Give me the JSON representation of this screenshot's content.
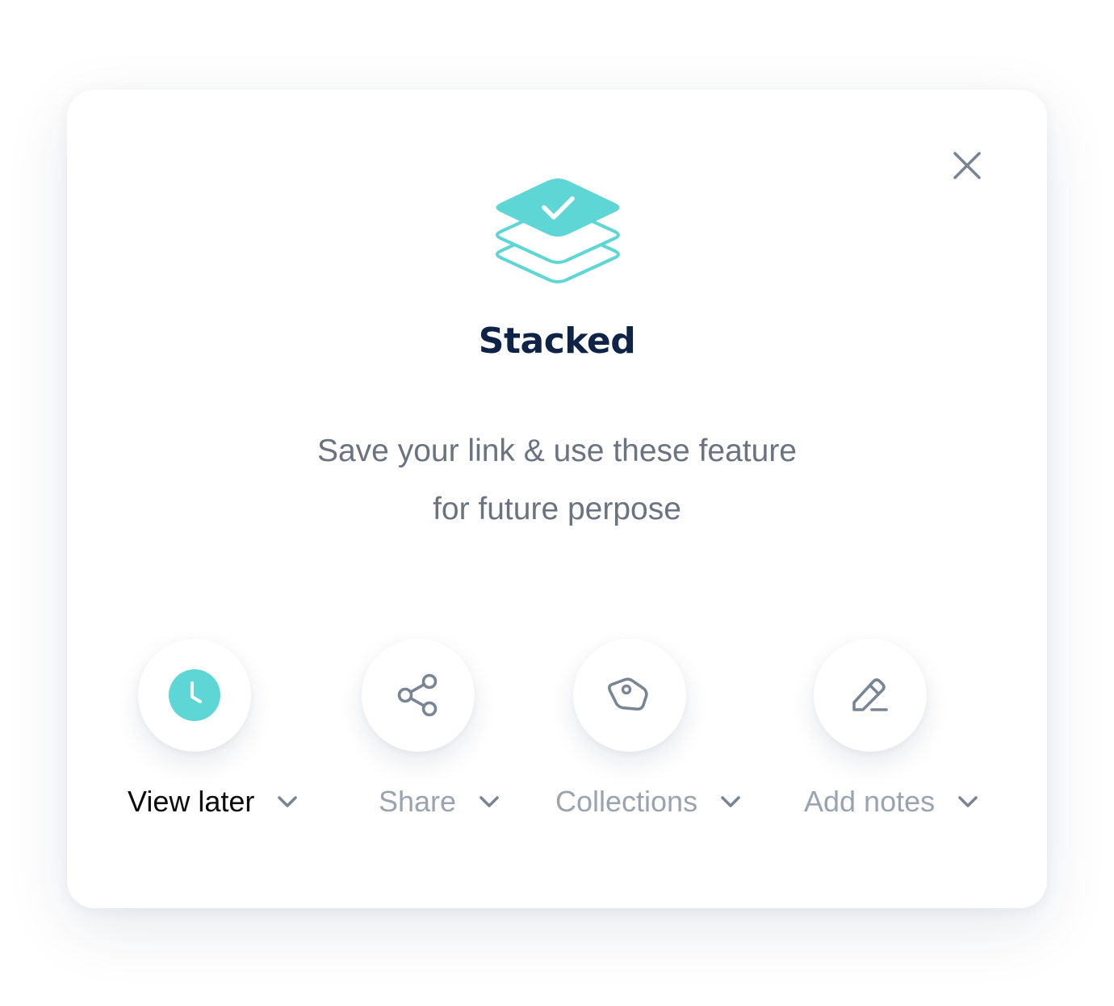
{
  "dialog": {
    "brand_name": "Stacked",
    "tagline_line1": "Save your link & use these feature",
    "tagline_line2": "for future perpose",
    "close_icon": "close-icon",
    "logo_icon": "stacked-layers-check-icon"
  },
  "colors": {
    "accent": "#5ed6d6",
    "title": "#0f2347",
    "body_text": "#6b7280",
    "inactive_label": "#9aa3ae",
    "icon_gray": "#7a8594",
    "active_label": "#0b0b0b"
  },
  "actions": [
    {
      "label": "View later",
      "icon": "clock-icon",
      "active": true
    },
    {
      "label": "Share",
      "icon": "share-icon",
      "active": false
    },
    {
      "label": "Collections",
      "icon": "tag-icon",
      "active": false
    },
    {
      "label": "Add notes",
      "icon": "pencil-icon",
      "active": false
    }
  ]
}
